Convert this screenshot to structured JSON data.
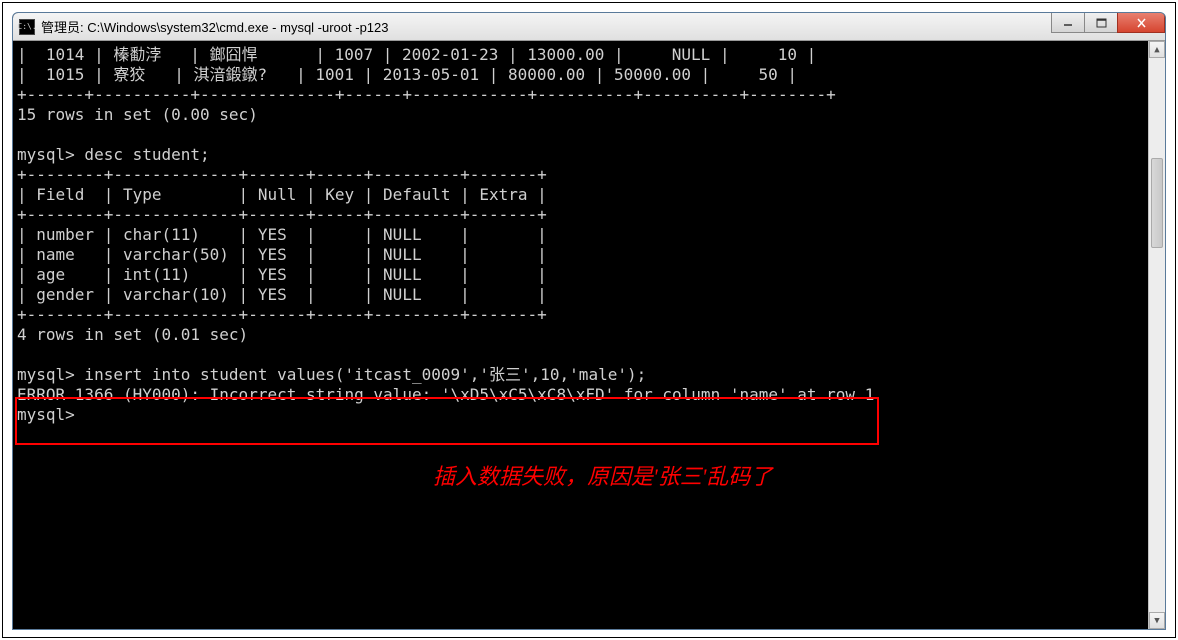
{
  "window": {
    "title": "管理员: C:\\Windows\\system32\\cmd.exe - mysql  -uroot -p123",
    "icon_label": "C:\\."
  },
  "terminal": {
    "data_rows": [
      {
        "c1": "1014",
        "c2": "榛勫浡",
        "c3": "鎯囧悍",
        "c4": "1007",
        "c5": "2002-01-23",
        "c6": "13000.00",
        "c7": "NULL",
        "c8": "10"
      },
      {
        "c1": "1015",
        "c2": "寮狡",
        "c3": "淇湆鍛鐓?",
        "c4": "1001",
        "c5": "2013-05-01",
        "c6": "80000.00",
        "c7": "50000.00",
        "c8": "50"
      }
    ],
    "border_top": "+------+----------+--------------+------+------------+----------+----------+--------+",
    "rows_msg1": "15 rows in set (0.00 sec)",
    "prompt1": "mysql> desc student;",
    "desc_border": "+--------+-------------+------+-----+---------+-------+",
    "desc_header": "| Field  | Type        | Null | Key | Default | Extra |",
    "desc_rows": [
      "| number | char(11)    | YES  |     | NULL    |       |",
      "| name   | varchar(50) | YES  |     | NULL    |       |",
      "| age    | int(11)     | YES  |     | NULL    |       |",
      "| gender | varchar(10) | YES  |     | NULL    |       |"
    ],
    "rows_msg2": "4 rows in set (0.01 sec)",
    "prompt2": "mysql> insert into student values('itcast_0009','张三',10,'male');",
    "error_line": "ERROR 1366 (HY000): Incorrect string value: '\\xD5\\xC5\\xC8\\xFD' for column 'name' at row 1",
    "prompt3": "mysql>"
  },
  "annotation": "插入数据失败，原因是'张三'乱码了"
}
